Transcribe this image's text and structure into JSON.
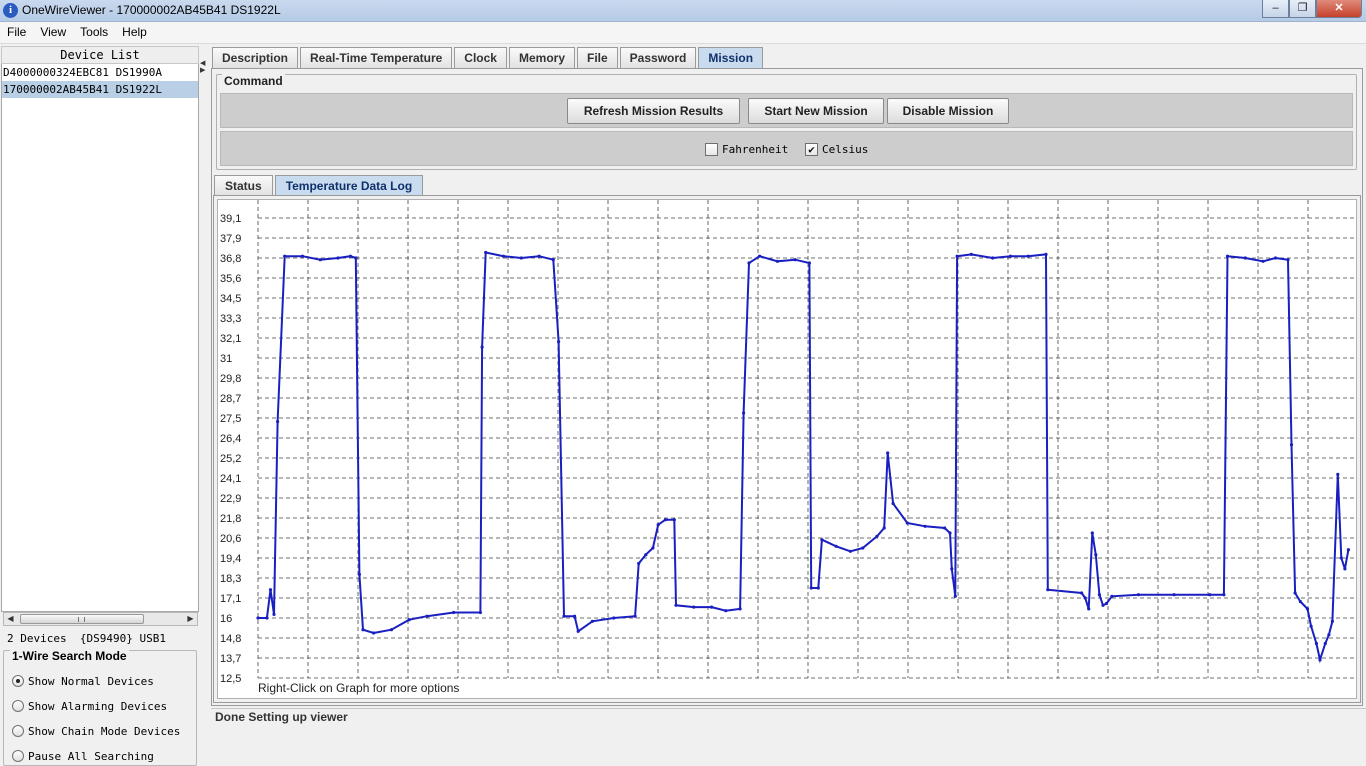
{
  "window": {
    "title": "OneWireViewer - 170000002AB45B41 DS1922L",
    "icon": "info-icon"
  },
  "menu": [
    "File",
    "View",
    "Tools",
    "Help"
  ],
  "device_list": {
    "header": "Device List",
    "items": [
      {
        "label": "D4000000324EBC81  DS1990A",
        "selected": false
      },
      {
        "label": "170000002AB45B41  DS1922L",
        "selected": true
      }
    ]
  },
  "devices_status": "2 Devices  {DS9490} USB1",
  "search_mode": {
    "title": "1-Wire Search Mode",
    "options": [
      {
        "label": "Show Normal Devices",
        "selected": true
      },
      {
        "label": "Show Alarming Devices",
        "selected": false
      },
      {
        "label": "Show Chain Mode Devices",
        "selected": false
      },
      {
        "label": "Pause All Searching",
        "selected": false
      }
    ]
  },
  "tabs": [
    {
      "label": "Description",
      "active": false
    },
    {
      "label": "Real-Time Temperature",
      "active": false
    },
    {
      "label": "Clock",
      "active": false
    },
    {
      "label": "Memory",
      "active": false
    },
    {
      "label": "File",
      "active": false
    },
    {
      "label": "Password",
      "active": false
    },
    {
      "label": "Mission",
      "active": true
    }
  ],
  "command": {
    "title": "Command",
    "buttons": [
      "Refresh Mission Results",
      "Start New Mission",
      "Disable Mission"
    ],
    "units": [
      {
        "label": "Fahrenheit",
        "checked": false
      },
      {
        "label": "Celsius",
        "checked": true
      }
    ]
  },
  "subtabs": [
    {
      "label": "Status",
      "active": false
    },
    {
      "label": "Temperature Data Log",
      "active": true
    }
  ],
  "chart_data": {
    "type": "line",
    "y_ticks": [
      "39,1",
      "37,9",
      "36,8",
      "35,6",
      "34,5",
      "33,3",
      "32,1",
      "31",
      "29,8",
      "28,7",
      "27,5",
      "26,4",
      "25,2",
      "24,1",
      "22,9",
      "21,8",
      "20,6",
      "19,4",
      "18,3",
      "17,1",
      "16",
      "14,8",
      "13,7",
      "12,5"
    ],
    "ylim": [
      12.5,
      39.1
    ],
    "grid": true,
    "color": "#1a1fc0",
    "hint": "Right-Click on Graph for more options",
    "points": [
      [
        0.0,
        16.0
      ],
      [
        0.5,
        16.0
      ],
      [
        0.7,
        17.6
      ],
      [
        0.9,
        16.2
      ],
      [
        1.1,
        27.3
      ],
      [
        1.5,
        36.9
      ],
      [
        2.5,
        36.9
      ],
      [
        3.5,
        36.7
      ],
      [
        4.5,
        36.8
      ],
      [
        5.2,
        36.9
      ],
      [
        5.5,
        36.8
      ],
      [
        5.7,
        18.5
      ],
      [
        5.9,
        15.3
      ],
      [
        6.5,
        15.1
      ],
      [
        7.5,
        15.3
      ],
      [
        8.5,
        15.9
      ],
      [
        9.5,
        16.1
      ],
      [
        11.0,
        16.3
      ],
      [
        12.5,
        16.3
      ],
      [
        12.6,
        31.6
      ],
      [
        12.8,
        37.1
      ],
      [
        13.8,
        36.9
      ],
      [
        14.8,
        36.8
      ],
      [
        15.8,
        36.9
      ],
      [
        16.6,
        36.7
      ],
      [
        16.9,
        31.9
      ],
      [
        17.2,
        16.1
      ],
      [
        17.8,
        16.1
      ],
      [
        18.0,
        15.2
      ],
      [
        18.8,
        15.8
      ],
      [
        20.0,
        16.0
      ],
      [
        21.2,
        16.1
      ],
      [
        21.4,
        19.1
      ],
      [
        21.8,
        19.6
      ],
      [
        22.2,
        20.0
      ],
      [
        22.5,
        21.4
      ],
      [
        22.9,
        21.7
      ],
      [
        23.4,
        21.7
      ],
      [
        23.5,
        16.7
      ],
      [
        24.5,
        16.6
      ],
      [
        25.5,
        16.6
      ],
      [
        26.3,
        16.4
      ],
      [
        27.1,
        16.5
      ],
      [
        27.3,
        27.8
      ],
      [
        27.6,
        36.5
      ],
      [
        28.2,
        36.9
      ],
      [
        29.2,
        36.6
      ],
      [
        30.2,
        36.7
      ],
      [
        31.0,
        36.5
      ],
      [
        31.1,
        17.7
      ],
      [
        31.5,
        17.7
      ],
      [
        31.7,
        20.5
      ],
      [
        32.5,
        20.1
      ],
      [
        33.3,
        19.8
      ],
      [
        34.0,
        20.0
      ],
      [
        34.8,
        20.7
      ],
      [
        35.2,
        21.2
      ],
      [
        35.4,
        25.5
      ],
      [
        35.7,
        22.6
      ],
      [
        36.5,
        21.5
      ],
      [
        37.5,
        21.3
      ],
      [
        38.6,
        21.2
      ],
      [
        38.9,
        20.9
      ],
      [
        39.0,
        18.8
      ],
      [
        39.2,
        17.2
      ],
      [
        39.3,
        36.9
      ],
      [
        40.1,
        37.0
      ],
      [
        41.3,
        36.8
      ],
      [
        42.3,
        36.9
      ],
      [
        43.3,
        36.9
      ],
      [
        44.3,
        37.0
      ],
      [
        44.4,
        17.6
      ],
      [
        46.3,
        17.4
      ],
      [
        46.5,
        17.1
      ],
      [
        46.7,
        16.5
      ],
      [
        46.9,
        20.9
      ],
      [
        47.1,
        19.6
      ],
      [
        47.3,
        17.3
      ],
      [
        47.5,
        16.7
      ],
      [
        47.7,
        16.8
      ],
      [
        48.0,
        17.2
      ],
      [
        49.5,
        17.3
      ],
      [
        51.5,
        17.3
      ],
      [
        53.5,
        17.3
      ],
      [
        54.3,
        17.3
      ],
      [
        54.5,
        36.9
      ],
      [
        55.5,
        36.8
      ],
      [
        56.5,
        36.6
      ],
      [
        57.2,
        36.8
      ],
      [
        57.9,
        36.7
      ],
      [
        58.1,
        26.0
      ],
      [
        58.3,
        17.4
      ],
      [
        58.6,
        16.9
      ],
      [
        59.0,
        16.5
      ],
      [
        59.2,
        15.5
      ],
      [
        59.5,
        14.5
      ],
      [
        59.7,
        13.6
      ],
      [
        60.0,
        14.5
      ],
      [
        60.2,
        15.0
      ],
      [
        60.4,
        15.8
      ],
      [
        60.7,
        24.3
      ],
      [
        60.9,
        19.4
      ],
      [
        61.1,
        18.8
      ],
      [
        61.3,
        19.9
      ]
    ]
  },
  "statusbar": "Done Setting up viewer"
}
